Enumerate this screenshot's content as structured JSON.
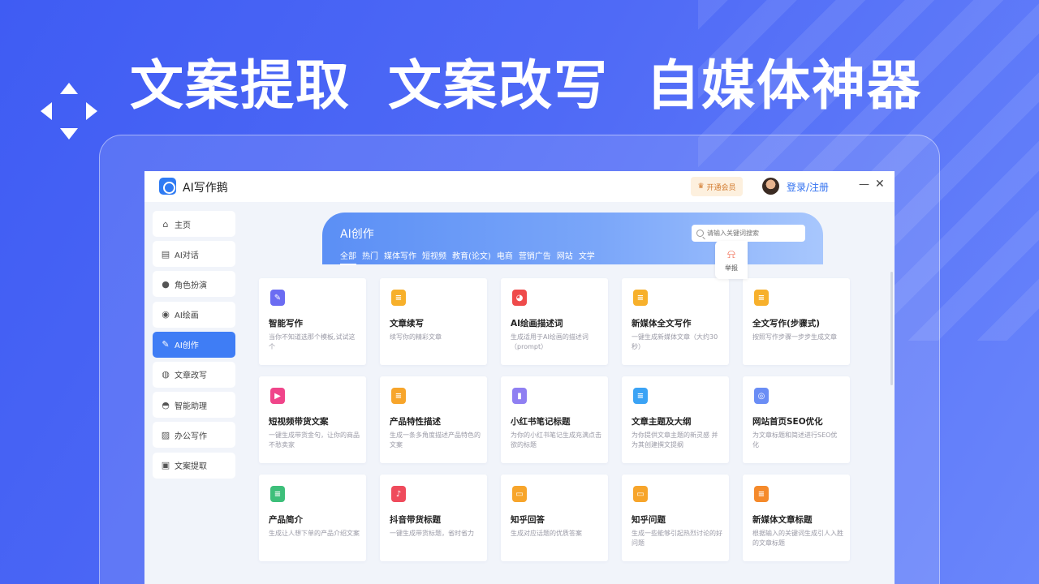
{
  "headline": [
    "文案提取",
    "文案改写",
    "自媒体神器"
  ],
  "app": {
    "title": "AI写作鹅",
    "vip_label": "开通会员",
    "login_label": "登录/注册",
    "minimize": "—",
    "close": "✕"
  },
  "sidebar": [
    {
      "label": "主页",
      "icon": "home-icon",
      "glyph": "⌂"
    },
    {
      "label": "AI对话",
      "icon": "chat-icon",
      "glyph": "▤"
    },
    {
      "label": "角色扮演",
      "icon": "speech-bubble-icon",
      "glyph": "●"
    },
    {
      "label": "AI绘画",
      "icon": "palette-icon",
      "glyph": "◉"
    },
    {
      "label": "AI创作",
      "icon": "edit-icon",
      "glyph": "✎",
      "active": true
    },
    {
      "label": "文章改写",
      "icon": "bulb-icon",
      "glyph": "◍"
    },
    {
      "label": "智能助理",
      "icon": "assistant-icon",
      "glyph": "◓"
    },
    {
      "label": "办公写作",
      "icon": "document-edit-icon",
      "glyph": "▨"
    },
    {
      "label": "文案提取",
      "icon": "extract-icon",
      "glyph": "▣"
    }
  ],
  "banner": {
    "title": "AI创作",
    "search_placeholder": "请输入关键词搜索"
  },
  "categories": [
    {
      "label": "全部",
      "active": true
    },
    {
      "label": "热门"
    },
    {
      "label": "媒体写作"
    },
    {
      "label": "短视频"
    },
    {
      "label": "教育(论文)"
    },
    {
      "label": "电商"
    },
    {
      "label": "营销广告"
    },
    {
      "label": "网站"
    },
    {
      "label": "文学"
    }
  ],
  "cards": [
    {
      "title": "智能写作",
      "desc": "当你不知道选那个模板,试试这个",
      "icon": "smart-write-icon",
      "color": "#6b6cf2",
      "glyph": "✎"
    },
    {
      "title": "文章续写",
      "desc": "续写你的精彩文章",
      "icon": "continue-write-icon",
      "color": "#f7b02b",
      "glyph": "≡"
    },
    {
      "title": "AI绘画描述词",
      "desc": "生成适用于AI绘画的描述词（prompt）",
      "icon": "ai-paint-icon",
      "color": "#ef4b4b",
      "glyph": "◕"
    },
    {
      "title": "新媒体全文写作",
      "desc": "一键生成新媒体文章（大约30秒）",
      "icon": "media-article-icon",
      "color": "#f7b02b",
      "glyph": "≡"
    },
    {
      "title": "全文写作(步骤式)",
      "desc": "按照写作步骤一步步生成文章",
      "icon": "step-write-icon",
      "color": "#f7b02b",
      "glyph": "≡"
    },
    {
      "title": "短视频带货文案",
      "desc": "一键生成带货金句，让你的商品不愁卖家",
      "icon": "video-copy-icon",
      "color": "#f0458a",
      "glyph": "▶"
    },
    {
      "title": "产品特性描述",
      "desc": "生成一条多角度描述产品特色的文案",
      "icon": "product-feature-icon",
      "color": "#f7a52b",
      "glyph": "≡"
    },
    {
      "title": "小红书笔记标题",
      "desc": "为你的小红书笔记生成充满点击欲的标题",
      "icon": "note-title-icon",
      "color": "#8f7ff2",
      "glyph": "▮"
    },
    {
      "title": "文章主题及大纲",
      "desc": "为你提供文章主题的新灵感 并为其创建撰文提纲",
      "icon": "outline-icon",
      "color": "#3ba3f5",
      "glyph": "≡"
    },
    {
      "title": "网站首页SEO优化",
      "desc": "为文章标题和简述进行SEO优化",
      "icon": "seo-planet-icon",
      "color": "#6a8df5",
      "glyph": "◎"
    },
    {
      "title": "产品简介",
      "desc": "生成让人想下单的产品介绍文案",
      "icon": "product-intro-icon",
      "color": "#3dbf7a",
      "glyph": "≡"
    },
    {
      "title": "抖音带货标题",
      "desc": "一键生成带货标题，省时省力",
      "icon": "douyin-icon",
      "color": "#ef4b5c",
      "glyph": "♪"
    },
    {
      "title": "知乎回答",
      "desc": "生成对应话题的优质答案",
      "icon": "zhihu-answer-icon",
      "color": "#f7a52b",
      "glyph": "▭"
    },
    {
      "title": "知乎问题",
      "desc": "生成一些能够引起热烈讨论的好问题",
      "icon": "zhihu-question-icon",
      "color": "#f7a52b",
      "glyph": "▭"
    },
    {
      "title": "新媒体文章标题",
      "desc": "根据输入的关键词生成引人入胜的文章标题",
      "icon": "media-title-icon",
      "color": "#f58a2b",
      "glyph": "≡"
    }
  ],
  "report_label": "举报"
}
